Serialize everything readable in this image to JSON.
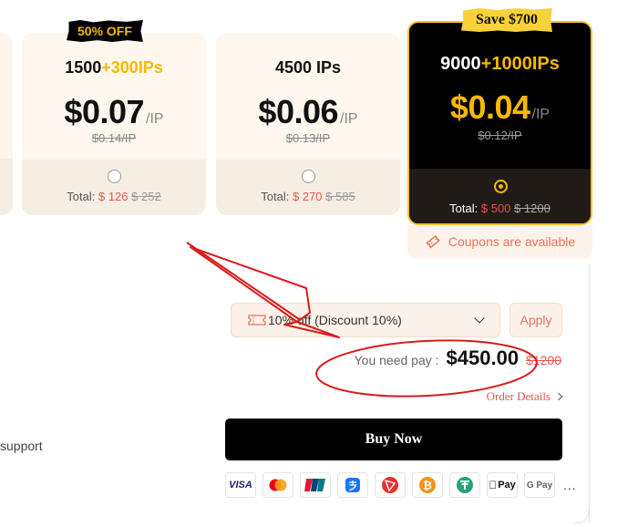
{
  "plans": [
    {
      "badge": "50% OFF",
      "qty": "1500",
      "bonus": "+300IPs",
      "price": "$0.07",
      "unit": "/IP",
      "orig_price": "$0.14/IP",
      "total_label": "Total:",
      "total_now": "$ 126",
      "total_was": "$ 252"
    },
    {
      "qty": "4500 IPs",
      "price": "$0.06",
      "unit": "/IP",
      "orig_price": "$0.13/IP",
      "total_label": "Total:",
      "total_now": "$ 270",
      "total_was": "$ 585"
    },
    {
      "badge": "Save $700",
      "qty": "9000",
      "bonus": "+1000IPs",
      "price": "$0.04",
      "unit": "/IP",
      "orig_price": "$0.12/IP",
      "total_label": "Total:",
      "total_now": "$ 500",
      "total_was": "$ 1200",
      "selected": true
    }
  ],
  "coupons_available": "Coupons are available",
  "coupon_select": {
    "value": "10% off (Discount 10%)"
  },
  "apply_label": "Apply",
  "pay": {
    "label": "You need pay :",
    "amount": "$450.00",
    "was": "$1200"
  },
  "order_details": "Order Details",
  "support_text": "support",
  "buy_label": "Buy Now",
  "payment_methods": [
    "VISA",
    "mastercard-icon",
    "unionpay-icon",
    "alipay-icon",
    "tron-icon",
    "bitcoin-icon",
    "tether-icon",
    "Pay",
    "G Pay"
  ],
  "applepay_label": "Pay",
  "gpay_label": "G Pay",
  "more_label": "...",
  "colors": {
    "accent": "#f6b900",
    "price_red": "#e8554e",
    "annotation_red": "#d91c1c"
  }
}
